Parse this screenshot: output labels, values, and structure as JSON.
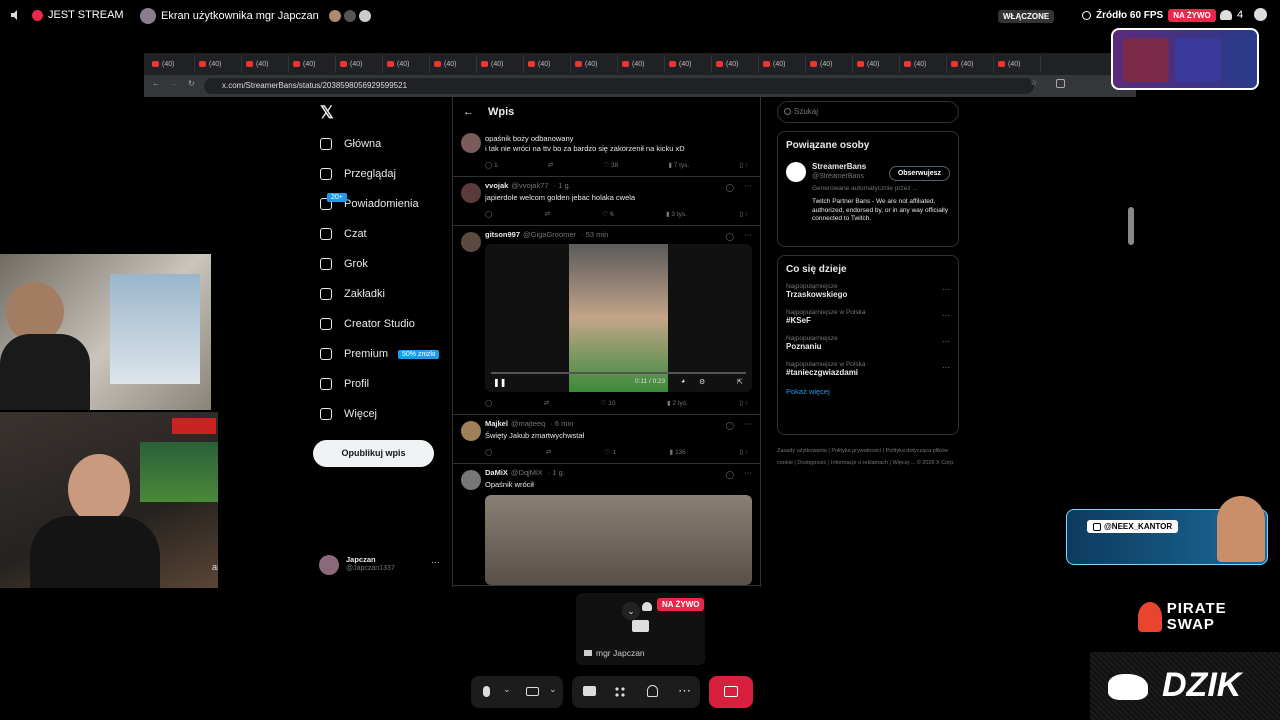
{
  "topbar": {
    "stream_status": "JEST STREAM",
    "screen_title": "Ekran użytkownika mgr Japczan",
    "included_label": "WŁĄCZONE",
    "source_label": "Źródło 60 FPS",
    "live_label": "NA ŻYWO",
    "viewers": "4"
  },
  "browser": {
    "tab_label": "(40)",
    "tab_count": 19,
    "url": "x.com/StreamerBans/status/2038598056929599521"
  },
  "nav": {
    "items": [
      "Główna",
      "Przeglądaj",
      "Powiadomienia",
      "Czat",
      "Grok",
      "Zakładki",
      "Creator Studio",
      "Premium",
      "Profil",
      "Więcej"
    ],
    "notif_badge": "20+",
    "premium_promo": "50% zniżki",
    "post_button": "Opublikuj wpis",
    "user_name": "Japczan",
    "user_handle": "@Japczan1337"
  },
  "feed": {
    "title": "Wpis",
    "tweets": [
      {
        "name": "",
        "handle": "",
        "time": "",
        "text": "opaśnik boży odbanowany\ni tak nie wróci na ttv bo za bardzo się zakorzenił na kicku xD",
        "replies": "1",
        "likes": "38",
        "views": "7 tys."
      },
      {
        "name": "vvojak",
        "handle": "@vvojak77",
        "time": "· 1 g.",
        "text": "japierdole welcom golden jebac holaka cwela",
        "replies": "",
        "likes": "6",
        "views": "3 tys."
      },
      {
        "name": "gitson997",
        "handle": "@GigaGroomer",
        "time": "· 53 min",
        "text": "",
        "video_time": "0:11 / 0:23",
        "replies": "",
        "likes": "10",
        "views": "2 tys."
      },
      {
        "name": "Majkel",
        "handle": "@majteeq",
        "time": "· 6 min",
        "text": "Święty Jakub zmartwychwstał",
        "replies": "",
        "likes": "1",
        "views": "136"
      },
      {
        "name": "DaMiX",
        "handle": "@DqjMiX",
        "time": "· 1 g.",
        "text": "Opaśnik wrócił",
        "replies": "",
        "likes": "",
        "views": ""
      }
    ]
  },
  "sidebar": {
    "search_placeholder": "Szukaj",
    "related_title": "Powiązane osoby",
    "related_name": "StreamerBans",
    "related_handle": "@StreamerBans",
    "related_auto": "Generowane automatycznie przez ...",
    "related_bio": "Twitch Partner Bans - We are not affiliated, authorized, endorsed by, or in any way officially connected to Twitch.",
    "follow_label": "Obserwujesz",
    "trends_title": "Co się dzieje",
    "trends": [
      {
        "cat": "Najpopularniejsze",
        "name": "Trzaskowskiego"
      },
      {
        "cat": "Najpopularniejsze w Polska",
        "name": "#KSeF"
      },
      {
        "cat": "Najpopularniejsze",
        "name": "Poznaniu"
      },
      {
        "cat": "Najpopularniejsze w Polska",
        "name": "#tanieczgwiazdami"
      }
    ],
    "show_more": "Pokaż więcej",
    "footer": "Zasady użytkowania | Polityka prywatności | Polityka dotycząca plików cookie | Dostępność | Informacje o reklamach | Więcej ... © 2026 X Corp."
  },
  "call": {
    "live_label": "NA ŻYWO",
    "presenter": "mgr Japczan",
    "cam_caption": "an"
  },
  "overlays": {
    "ig_handle": "@NEEX_KANTOR",
    "sponsor1": "PIRATE SWAP",
    "sponsor2": "DZIK"
  }
}
